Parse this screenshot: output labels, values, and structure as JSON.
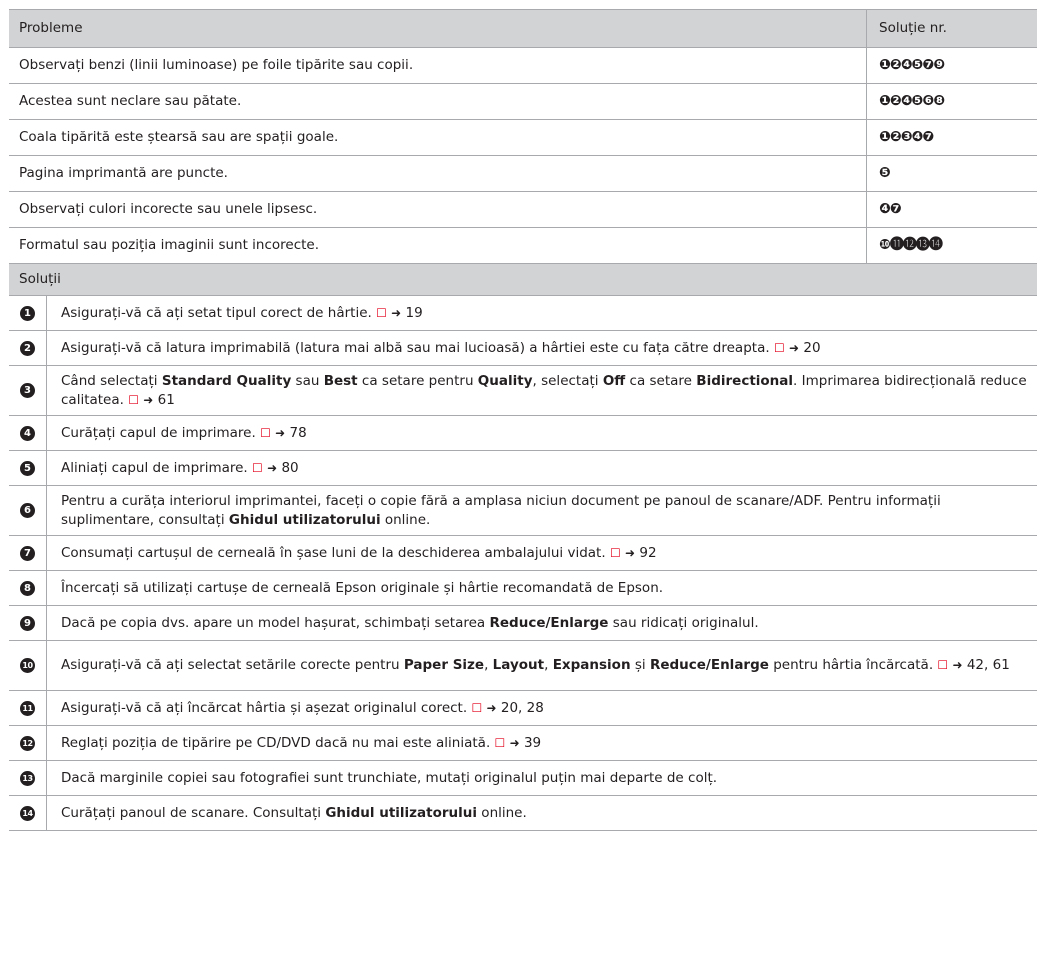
{
  "header": {
    "problems": "Probleme",
    "solution_no": "Soluție nr."
  },
  "problems": [
    {
      "text": "Observați benzi (linii luminoase) pe foile tipărite sau copii.",
      "solutions": "❶❷❹❺❼❾"
    },
    {
      "text": "Acestea sunt neclare sau pătate.",
      "solutions": "❶❷❹❺❻❽"
    },
    {
      "text": "Coala tipărită este ștearsă sau are spații goale.",
      "solutions": "❶❷❸❹❼"
    },
    {
      "text": "Pagina imprimantă are puncte.",
      "solutions": "❺"
    },
    {
      "text": "Observați culori incorecte sau unele lipsesc.",
      "solutions": "❹❼"
    },
    {
      "text": "Formatul sau poziția imaginii sunt incorecte.",
      "solutions": "❿⓫⓬⓭⓮"
    }
  ],
  "solutions_header": "Soluții",
  "solutions": [
    {
      "num": "1",
      "t1": "Asigurați-vă că ați setat tipul corect de hârtie.",
      "ref": "19"
    },
    {
      "num": "2",
      "t1": "Asigurați-vă că latura imprimabilă (latura mai albă sau mai lucioasă) a hârtiei este cu fața către dreapta.",
      "ref": "20"
    },
    {
      "num": "3",
      "t1": "Când selectați ",
      "b1": "Standard Quality",
      "t2": " sau ",
      "b2": "Best",
      "t3": " ca setare pentru ",
      "b3": "Quality",
      "t4": ", selectați ",
      "b4": "Off",
      "t5": " ca setare ",
      "b5": "Bidirectional",
      "t6": ". Imprimarea bidirecțională reduce calitatea.",
      "ref": "61"
    },
    {
      "num": "4",
      "t1": "Curățați capul de imprimare.",
      "ref": "78"
    },
    {
      "num": "5",
      "t1": "Aliniați capul de imprimare.",
      "ref": "80"
    },
    {
      "num": "6",
      "t1": "Pentru a curăța interiorul imprimantei, faceți o copie fără a amplasa niciun document pe panoul de scanare/ADF. Pentru informații suplimentare, consultați ",
      "b1": "Ghidul utilizatorului",
      "t2": " online."
    },
    {
      "num": "7",
      "t1": "Consumați cartușul de cerneală în șase luni de la deschiderea ambalajului vidat.",
      "ref": "92"
    },
    {
      "num": "8",
      "t1": "Încercați să utilizați cartușe de cerneală Epson originale și hârtie recomandată de Epson."
    },
    {
      "num": "9",
      "t1": "Dacă pe copia dvs. apare un model hașurat, schimbați setarea ",
      "b1": "Reduce/Enlarge",
      "t2": " sau ridicați originalul."
    },
    {
      "num": "10",
      "t1": "Asigurați-vă că ați selectat setările corecte pentru ",
      "b1": "Paper Size",
      "t2": ", ",
      "b2": "Layout",
      "t3": ", ",
      "b3": "Expansion",
      "t4": " și ",
      "b4": "Reduce/Enlarge",
      "t5": " pentru hârtia încărcată.",
      "ref": "42, 61"
    },
    {
      "num": "11",
      "t1": "Asigurați-vă că ați încărcat hârtia și așezat originalul corect.",
      "ref": "20, 28"
    },
    {
      "num": "12",
      "t1": "Reglați poziția de tipărire pe CD/DVD dacă nu mai este aliniată.",
      "ref": "39"
    },
    {
      "num": "13",
      "t1": "Dacă marginile copiei sau fotografiei sunt trunchiate, mutați originalul puțin mai departe de colț."
    },
    {
      "num": "14",
      "t1": "Curățați panoul de scanare. Consultați ",
      "b1": "Ghidul utilizatorului",
      "t2": " online."
    }
  ],
  "icons": {
    "book": "book-icon",
    "arrow": "arrow-right-icon"
  },
  "colors": {
    "header_bg": "#d2d3d4",
    "border": "#a7a9ac",
    "text": "#231f20",
    "book_icon": "#e2001a"
  }
}
